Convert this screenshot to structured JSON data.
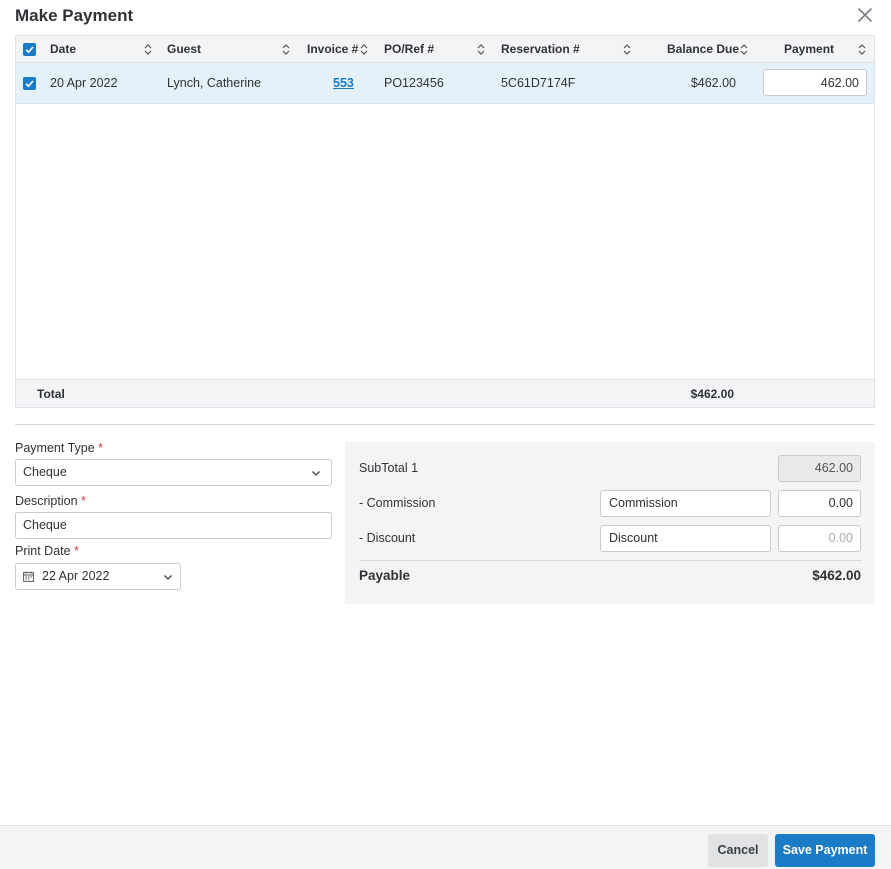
{
  "dialog": {
    "title": "Make Payment"
  },
  "grid": {
    "columns": {
      "date": "Date",
      "guest": "Guest",
      "invoice": "Invoice #",
      "po_ref": "PO/Ref #",
      "reservation": "Reservation #",
      "balance_due": "Balance Due",
      "payment": "Payment"
    },
    "rows": [
      {
        "selected": true,
        "date": "20 Apr 2022",
        "guest": "Lynch, Catherine",
        "invoice": "553",
        "po_ref": "PO123456",
        "reservation": "5C61D7174F",
        "balance_due": "$462.00",
        "payment": "462.00"
      }
    ],
    "footer": {
      "label": "Total",
      "balance_total": "$462.00"
    }
  },
  "form": {
    "payment_type": {
      "label": "Payment Type",
      "required_mark": "*",
      "value": "Cheque"
    },
    "description": {
      "label": "Description",
      "required_mark": "*",
      "value": "Cheque"
    },
    "print_date": {
      "label": "Print Date",
      "required_mark": "*",
      "value": "22 Apr 2022"
    }
  },
  "summary": {
    "subtotal": {
      "label": "SubTotal 1",
      "value": "462.00"
    },
    "commission": {
      "label": "- Commission",
      "text_value": "Commission",
      "amount": "0.00"
    },
    "discount": {
      "label": "- Discount",
      "text_value": "Discount",
      "amount": "0.00"
    },
    "payable": {
      "label": "Payable",
      "value": "$462.00"
    }
  },
  "footer": {
    "cancel_label": "Cancel",
    "save_label": "Save Payment"
  },
  "colors": {
    "accent": "#1a7cc6",
    "selected_row": "#e4f1f9",
    "required": "#d23a3a"
  },
  "icons": [
    "close-icon",
    "sort-icon",
    "checkbox-checked-icon",
    "chevron-down-icon",
    "calendar-icon"
  ]
}
